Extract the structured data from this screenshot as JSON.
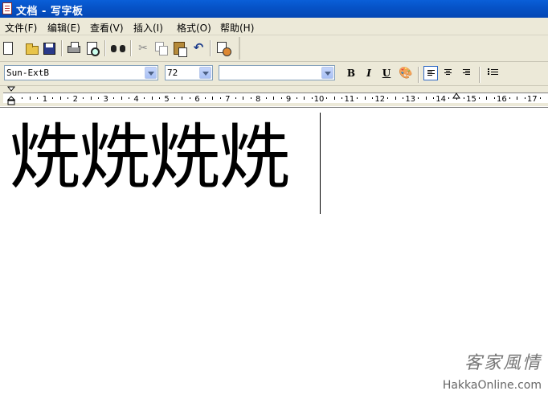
{
  "window": {
    "title": "文档 - 写字板"
  },
  "menu": [
    {
      "label": "文件(F)"
    },
    {
      "label": "编辑(E)"
    },
    {
      "label": "查看(V)"
    },
    {
      "label": "插入(I)"
    },
    {
      "label": "格式(O)"
    },
    {
      "label": "帮助(H)"
    }
  ],
  "toolbar": {
    "icons": [
      "new-document-icon",
      "open-folder-icon",
      "save-disk-icon",
      "print-icon",
      "print-preview-icon",
      "find-binoculars-icon",
      "cut-scissors-icon",
      "copy-icon",
      "paste-icon",
      "undo-icon",
      "insert-datetime-icon"
    ]
  },
  "format": {
    "font_name": "Sun-ExtB",
    "font_size": "72",
    "script": "",
    "bold_label": "B",
    "italic_label": "I",
    "underline_label": "U",
    "alignment_selected": "left"
  },
  "ruler": {
    "labels": [
      "1",
      "2",
      "3",
      "4",
      "5",
      "6",
      "7",
      "8",
      "9",
      "10",
      "11",
      "12",
      "13",
      "14",
      "15",
      "16",
      "17"
    ]
  },
  "document": {
    "content": "烍烍烍烍"
  },
  "watermark": {
    "chinese": "客家風情",
    "url": "HakkaOnline.com"
  },
  "colors": {
    "titlebar": "#0553c8",
    "chrome": "#ece9d8",
    "combo_border": "#7f9db9"
  }
}
